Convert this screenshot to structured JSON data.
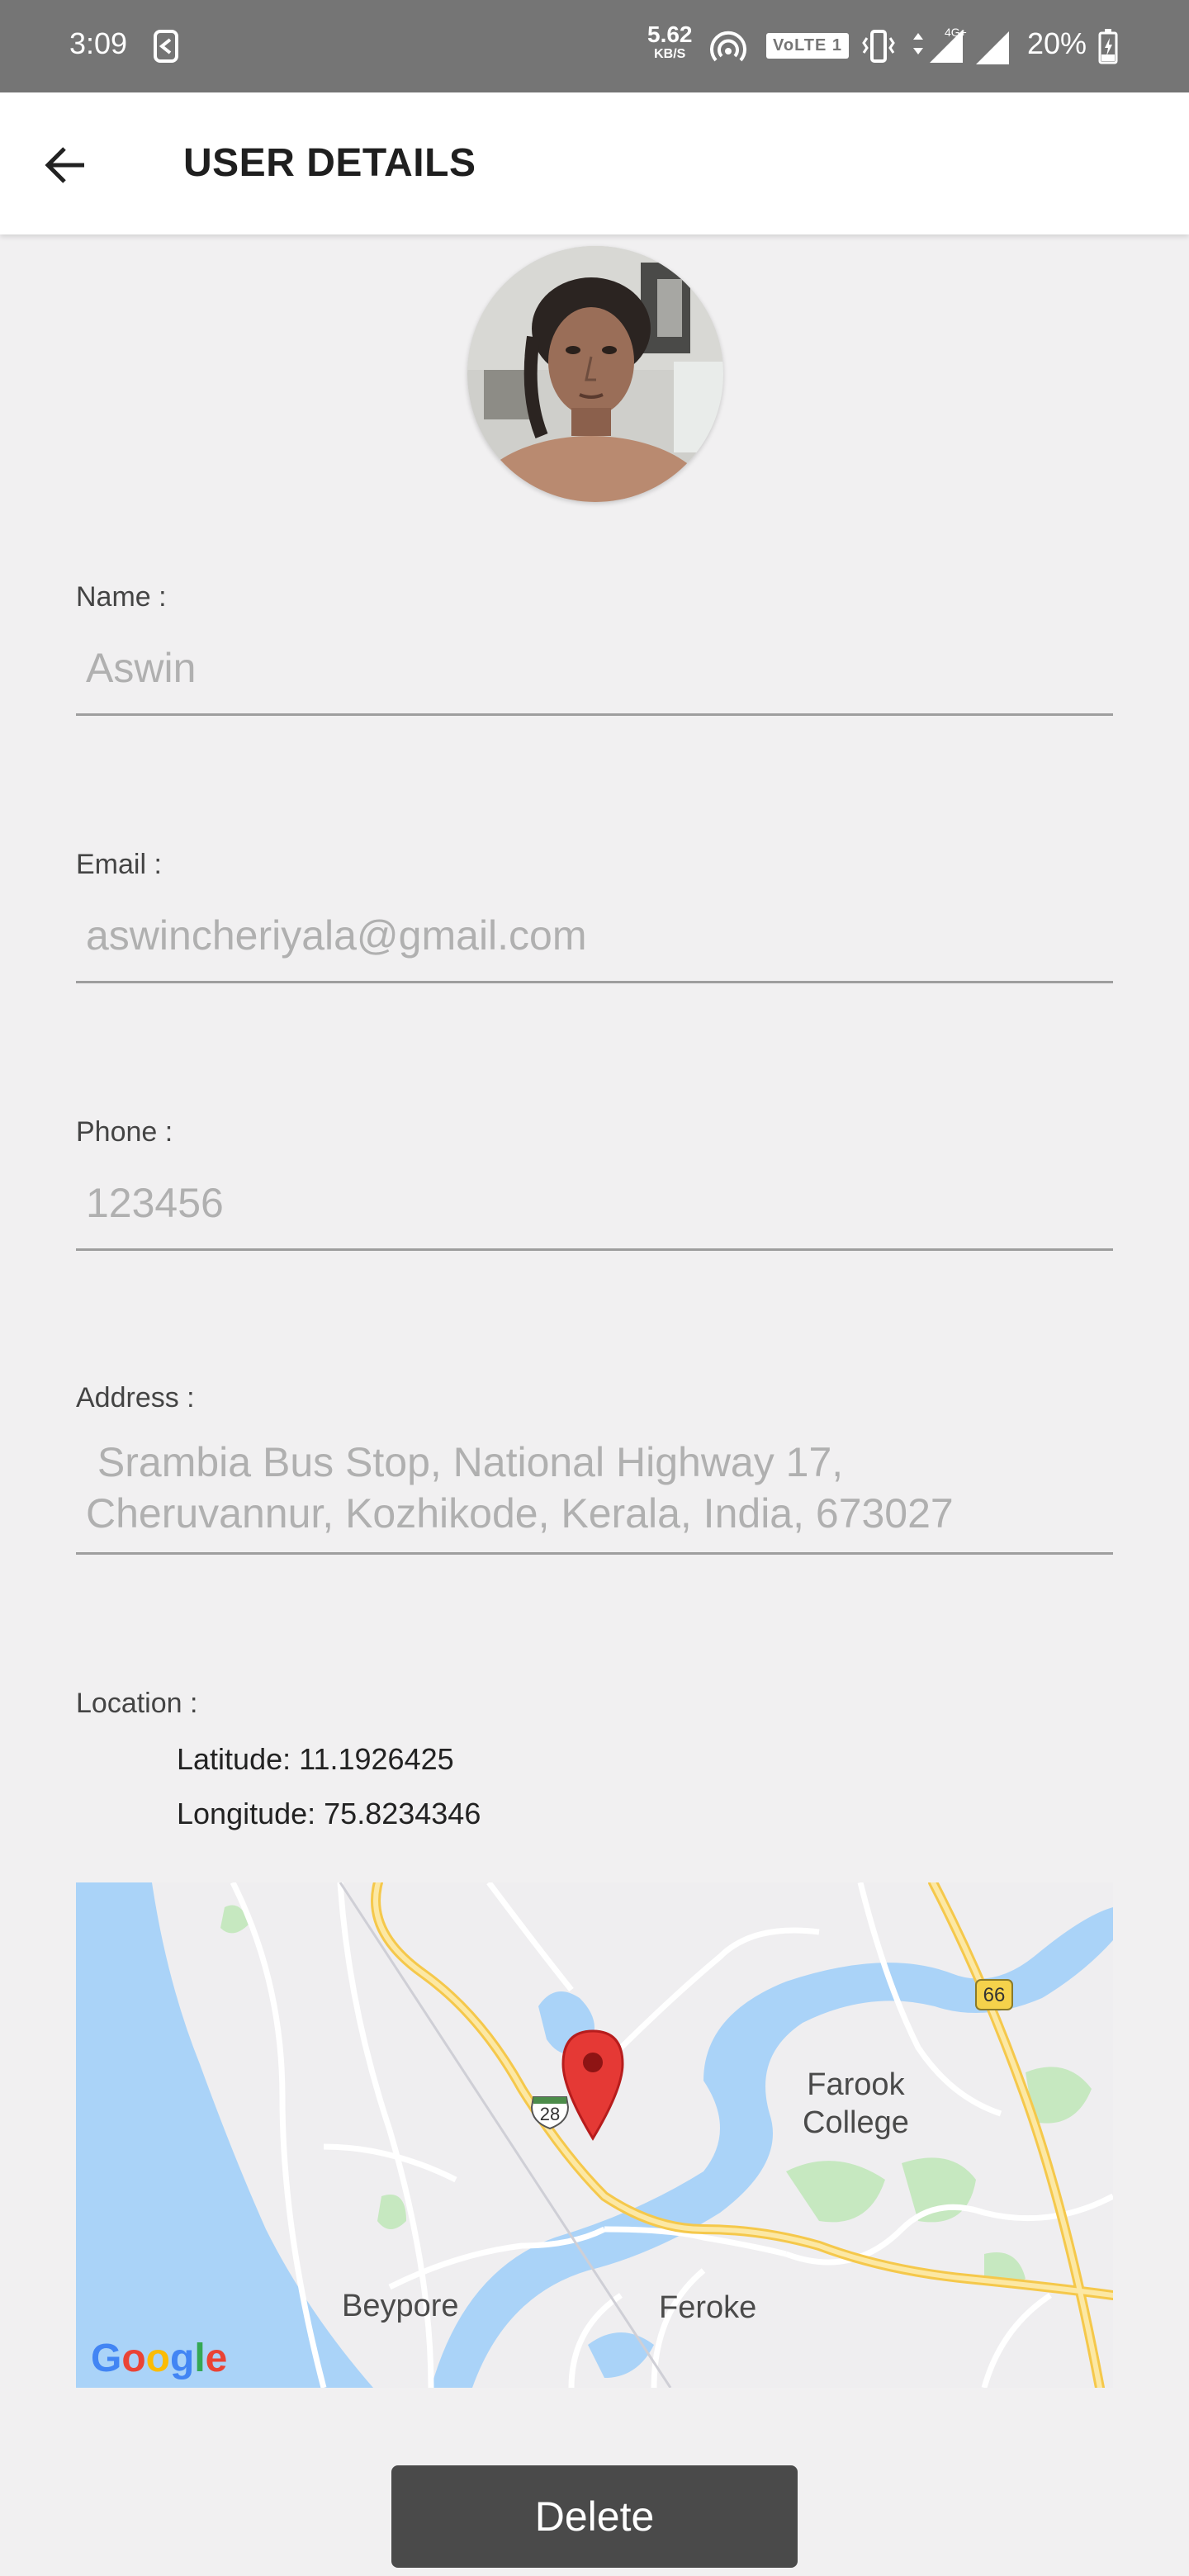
{
  "status_bar": {
    "time": "3:09",
    "net_speed_value": "5.62",
    "net_speed_unit": "KB/S",
    "volte": "VoLTE 1",
    "network_type": "4G+",
    "battery": "20%"
  },
  "app_bar": {
    "title": "USER DETAILS",
    "back_icon": "arrow-left-icon"
  },
  "fields": {
    "name": {
      "label": "Name :",
      "value": "Aswin"
    },
    "email": {
      "label": "Email :",
      "value": "aswincheriyala@gmail.com"
    },
    "phone": {
      "label": "Phone :",
      "value": "123456"
    },
    "address": {
      "label": "Address :",
      "line1": " Srambia Bus Stop, National Highway 17,",
      "line2": "Cheruvannur, Kozhikode, Kerala, India, 673027"
    }
  },
  "location": {
    "label": "Location :",
    "latitude": "Latitude: 11.1926425",
    "longitude": "Longitude: 75.8234346"
  },
  "map": {
    "labels": {
      "farook_1": "Farook",
      "farook_2": "College",
      "beypore": "Beypore",
      "feroke": "Feroke",
      "route_28": "28",
      "route_66": "66"
    },
    "logo": "Google",
    "colors": {
      "water": "#aad3f8",
      "land": "#efeef0",
      "highway": "#f8dc80",
      "park": "#c6e8c0",
      "pin": "#e53935"
    }
  },
  "actions": {
    "delete_label": "Delete"
  }
}
